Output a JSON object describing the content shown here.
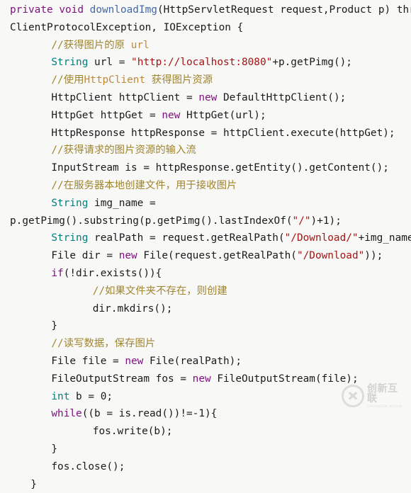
{
  "editor": {
    "language": "java",
    "background_color": "#f8f8f6",
    "default_text_color": "#1a1a1a",
    "syntax_colors": {
      "keyword": "#7f0f7f",
      "type": "#008080",
      "function": "#4169a8",
      "string": "#a31515",
      "comment": "#a08530",
      "plain": "#1a1a1a"
    },
    "lines": [
      {
        "id": 1,
        "indent": 0,
        "tokens": [
          {
            "t": "private",
            "c": "kw"
          },
          {
            "t": " ",
            "c": "plain"
          },
          {
            "t": "void",
            "c": "kw"
          },
          {
            "t": " ",
            "c": "plain"
          },
          {
            "t": "downloadImg",
            "c": "fn"
          },
          {
            "t": "(HttpServletRequest request,Product p) throws",
            "c": "plain"
          }
        ]
      },
      {
        "id": 2,
        "indent": 0,
        "tokens": [
          {
            "t": "ClientProtocolException, IOException {",
            "c": "plain"
          }
        ]
      },
      {
        "id": 3,
        "indent": 4,
        "tokens": [
          {
            "t": "//获得图片的原 ",
            "c": "cmt"
          },
          {
            "t": "url",
            "c": "cmt-hl"
          }
        ]
      },
      {
        "id": 4,
        "indent": 4,
        "tokens": [
          {
            "t": "String",
            "c": "type"
          },
          {
            "t": " url = ",
            "c": "plain"
          },
          {
            "t": "\"http://localhost:8080\"",
            "c": "str"
          },
          {
            "t": "+p.getPimg();",
            "c": "plain"
          }
        ]
      },
      {
        "id": 5,
        "indent": 4,
        "tokens": [
          {
            "t": "//使用",
            "c": "cmt"
          },
          {
            "t": "HttpClient",
            "c": "cmt-hl"
          },
          {
            "t": " 获得图片资源",
            "c": "cmt"
          }
        ]
      },
      {
        "id": 6,
        "indent": 4,
        "tokens": [
          {
            "t": "HttpClient httpClient = ",
            "c": "plain"
          },
          {
            "t": "new",
            "c": "kw"
          },
          {
            "t": " DefaultHttpClient();",
            "c": "plain"
          }
        ]
      },
      {
        "id": 7,
        "indent": 4,
        "tokens": [
          {
            "t": "HttpGet httpGet = ",
            "c": "plain"
          },
          {
            "t": "new",
            "c": "kw"
          },
          {
            "t": " HttpGet(url);",
            "c": "plain"
          }
        ]
      },
      {
        "id": 8,
        "indent": 4,
        "tokens": [
          {
            "t": "HttpResponse httpResponse = httpClient.execute(httpGet);",
            "c": "plain"
          }
        ]
      },
      {
        "id": 9,
        "indent": 4,
        "tokens": [
          {
            "t": "//获得请求的图片资源的输入流",
            "c": "cmt"
          }
        ]
      },
      {
        "id": 10,
        "indent": 4,
        "tokens": [
          {
            "t": "InputStream is = httpResponse.getEntity().getContent();",
            "c": "plain"
          }
        ]
      },
      {
        "id": 11,
        "indent": 4,
        "tokens": [
          {
            "t": "//在服务器本地创建文件，用于接收图片",
            "c": "cmt"
          }
        ]
      },
      {
        "id": 12,
        "indent": 4,
        "tokens": [
          {
            "t": "String",
            "c": "type"
          },
          {
            "t": " img_name = ",
            "c": "plain"
          }
        ]
      },
      {
        "id": 13,
        "indent": 0,
        "tokens": [
          {
            "t": "p.getPimg().substring(p.getPimg().lastIndexOf(",
            "c": "plain"
          },
          {
            "t": "\"/\"",
            "c": "str"
          },
          {
            "t": ")+1);",
            "c": "plain"
          }
        ]
      },
      {
        "id": 14,
        "indent": 4,
        "tokens": [
          {
            "t": "String",
            "c": "type"
          },
          {
            "t": " realPath = request.getRealPath(",
            "c": "plain"
          },
          {
            "t": "\"/Download/\"",
            "c": "str"
          },
          {
            "t": "+img_name);",
            "c": "plain"
          }
        ]
      },
      {
        "id": 15,
        "indent": 4,
        "tokens": [
          {
            "t": "File dir = ",
            "c": "plain"
          },
          {
            "t": "new",
            "c": "kw"
          },
          {
            "t": " File(request.getRealPath(",
            "c": "plain"
          },
          {
            "t": "\"/Download\"",
            "c": "str"
          },
          {
            "t": "));",
            "c": "plain"
          }
        ]
      },
      {
        "id": 16,
        "indent": 4,
        "tokens": [
          {
            "t": "if",
            "c": "kw"
          },
          {
            "t": "(!dir.exists()){",
            "c": "plain"
          }
        ]
      },
      {
        "id": 17,
        "indent": 8,
        "tokens": [
          {
            "t": "//如果文件夹不存在，则创建",
            "c": "cmt"
          }
        ]
      },
      {
        "id": 18,
        "indent": 8,
        "tokens": [
          {
            "t": "dir.mkdirs();",
            "c": "plain"
          }
        ]
      },
      {
        "id": 19,
        "indent": 4,
        "tokens": [
          {
            "t": "}",
            "c": "plain"
          }
        ]
      },
      {
        "id": 20,
        "indent": 4,
        "tokens": [
          {
            "t": "//读写数据，保存图片",
            "c": "cmt"
          }
        ]
      },
      {
        "id": 21,
        "indent": 4,
        "tokens": [
          {
            "t": "File file = ",
            "c": "plain"
          },
          {
            "t": "new",
            "c": "kw"
          },
          {
            "t": " File(realPath);",
            "c": "plain"
          }
        ]
      },
      {
        "id": 22,
        "indent": 4,
        "tokens": [
          {
            "t": "FileOutputStream fos = ",
            "c": "plain"
          },
          {
            "t": "new",
            "c": "kw"
          },
          {
            "t": " FileOutputStream(file);",
            "c": "plain"
          }
        ]
      },
      {
        "id": 23,
        "indent": 4,
        "tokens": [
          {
            "t": "int",
            "c": "type"
          },
          {
            "t": " b = ",
            "c": "plain"
          },
          {
            "t": "0",
            "c": "num"
          },
          {
            "t": ";",
            "c": "plain"
          }
        ]
      },
      {
        "id": 24,
        "indent": 4,
        "tokens": [
          {
            "t": "while",
            "c": "kw"
          },
          {
            "t": "((b = is.read())!=-",
            "c": "plain"
          },
          {
            "t": "1",
            "c": "num"
          },
          {
            "t": "){",
            "c": "plain"
          }
        ]
      },
      {
        "id": 25,
        "indent": 8,
        "tokens": [
          {
            "t": "fos.write(b);",
            "c": "plain"
          }
        ]
      },
      {
        "id": 26,
        "indent": 4,
        "tokens": [
          {
            "t": "}",
            "c": "plain"
          }
        ]
      },
      {
        "id": 27,
        "indent": 4,
        "tokens": [
          {
            "t": "fos.close();",
            "c": "plain"
          }
        ]
      },
      {
        "id": 28,
        "indent": 2,
        "tokens": [
          {
            "t": "}",
            "c": "plain"
          }
        ]
      }
    ]
  },
  "watermark": {
    "title": "创新互联",
    "subtitle": "CHUANGXIN HULIAN",
    "logo_icon": "circle-x-logo-icon"
  }
}
